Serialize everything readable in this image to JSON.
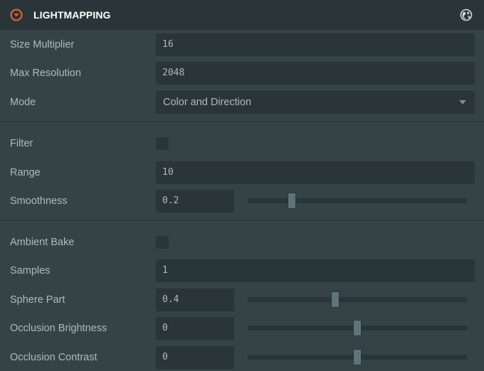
{
  "header": {
    "title": "LIGHTMAPPING",
    "collapse_icon": "chevron-circle-down-icon",
    "globe_icon": "globe-icon",
    "accent_color": "#f16728"
  },
  "fields": {
    "size_multiplier": {
      "label": "Size Multiplier",
      "value": "16"
    },
    "max_resolution": {
      "label": "Max Resolution",
      "value": "2048"
    },
    "mode": {
      "label": "Mode",
      "value": "Color and Direction"
    },
    "filter": {
      "label": "Filter",
      "checked": false
    },
    "range": {
      "label": "Range",
      "value": "10"
    },
    "smoothness": {
      "label": "Smoothness",
      "value": "0.2",
      "slider_fraction": 0.2
    },
    "ambient_bake": {
      "label": "Ambient Bake",
      "checked": false
    },
    "samples": {
      "label": "Samples",
      "value": "1"
    },
    "sphere_part": {
      "label": "Sphere Part",
      "value": "0.4",
      "slider_fraction": 0.4
    },
    "occlusion_brightness": {
      "label": "Occlusion Brightness",
      "value": "0",
      "slider_fraction": 0.5
    },
    "occlusion_contrast": {
      "label": "Occlusion Contrast",
      "value": "0",
      "slider_fraction": 0.5
    }
  }
}
